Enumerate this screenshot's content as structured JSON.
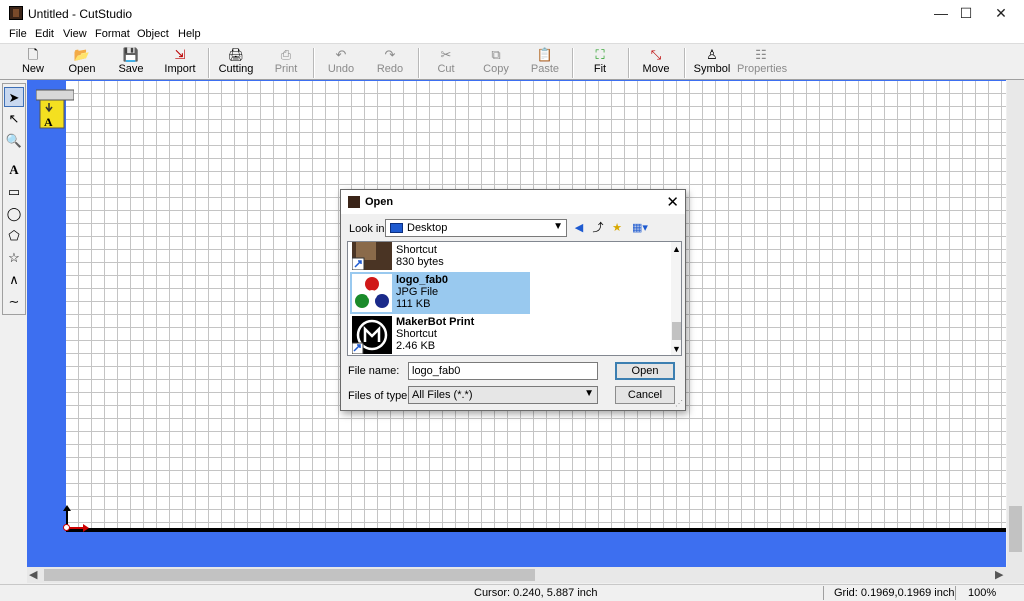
{
  "window": {
    "title": "Untitled - CutStudio",
    "minimize": "—",
    "maximize": "☐",
    "close": "✕"
  },
  "menu": [
    "File",
    "Edit",
    "View",
    "Format",
    "Object",
    "Help"
  ],
  "toolbar": [
    {
      "label": "New",
      "icon": "new-document-icon",
      "enabled": true
    },
    {
      "label": "Open",
      "icon": "open-folder-icon",
      "enabled": true
    },
    {
      "label": "Save",
      "icon": "save-disk-icon",
      "enabled": true
    },
    {
      "label": "Import",
      "icon": "import-icon",
      "enabled": true
    },
    {
      "label": "Cutting",
      "icon": "cutting-plotter-icon",
      "enabled": true
    },
    {
      "label": "Print",
      "icon": "printer-icon",
      "enabled": false
    },
    {
      "label": "Undo",
      "icon": "undo-icon",
      "enabled": false
    },
    {
      "label": "Redo",
      "icon": "redo-icon",
      "enabled": false
    },
    {
      "label": "Cut",
      "icon": "scissors-icon",
      "enabled": false
    },
    {
      "label": "Copy",
      "icon": "copy-icon",
      "enabled": false
    },
    {
      "label": "Paste",
      "icon": "paste-icon",
      "enabled": false
    },
    {
      "label": "Fit",
      "icon": "fit-icon",
      "enabled": true
    },
    {
      "label": "Move",
      "icon": "move-icon",
      "enabled": true
    },
    {
      "label": "Symbol",
      "icon": "symbol-icon",
      "enabled": true
    },
    {
      "label": "Properties",
      "icon": "properties-icon",
      "enabled": false
    }
  ],
  "tools": [
    "select-arrow-icon",
    "node-edit-icon",
    "zoom-icon",
    "text-tool-icon",
    "rectangle-icon",
    "ellipse-icon",
    "polygon-icon",
    "star-icon",
    "polyline-icon",
    "curve-icon"
  ],
  "tool_glyphs": {
    "text": "A"
  },
  "statusbar": {
    "cursor": "Cursor: 0.240, 5.887 inch",
    "grid": "Grid: 0.1969,0.1969 inch",
    "zoom": "100%"
  },
  "dialog": {
    "title": "Open",
    "look_in_label": "Look in:",
    "look_in_value": "Desktop",
    "files": [
      {
        "name": "",
        "type": "Shortcut",
        "size": "830 bytes",
        "selected": false
      },
      {
        "name": "logo_fab0",
        "type": "JPG File",
        "size": "111 KB",
        "selected": true
      },
      {
        "name": "MakerBot Print",
        "type": "Shortcut",
        "size": "2.46 KB",
        "selected": false
      }
    ],
    "file_name_label": "File name:",
    "file_name_value": "logo_fab0",
    "file_type_label": "Files of type:",
    "file_type_value": "All Files (*.*)",
    "open_button": "Open",
    "cancel_button": "Cancel"
  },
  "colors": {
    "canvas_frame": "#3d6ff0",
    "selection": "#99c9ef",
    "accent": "#3c7fb1"
  }
}
